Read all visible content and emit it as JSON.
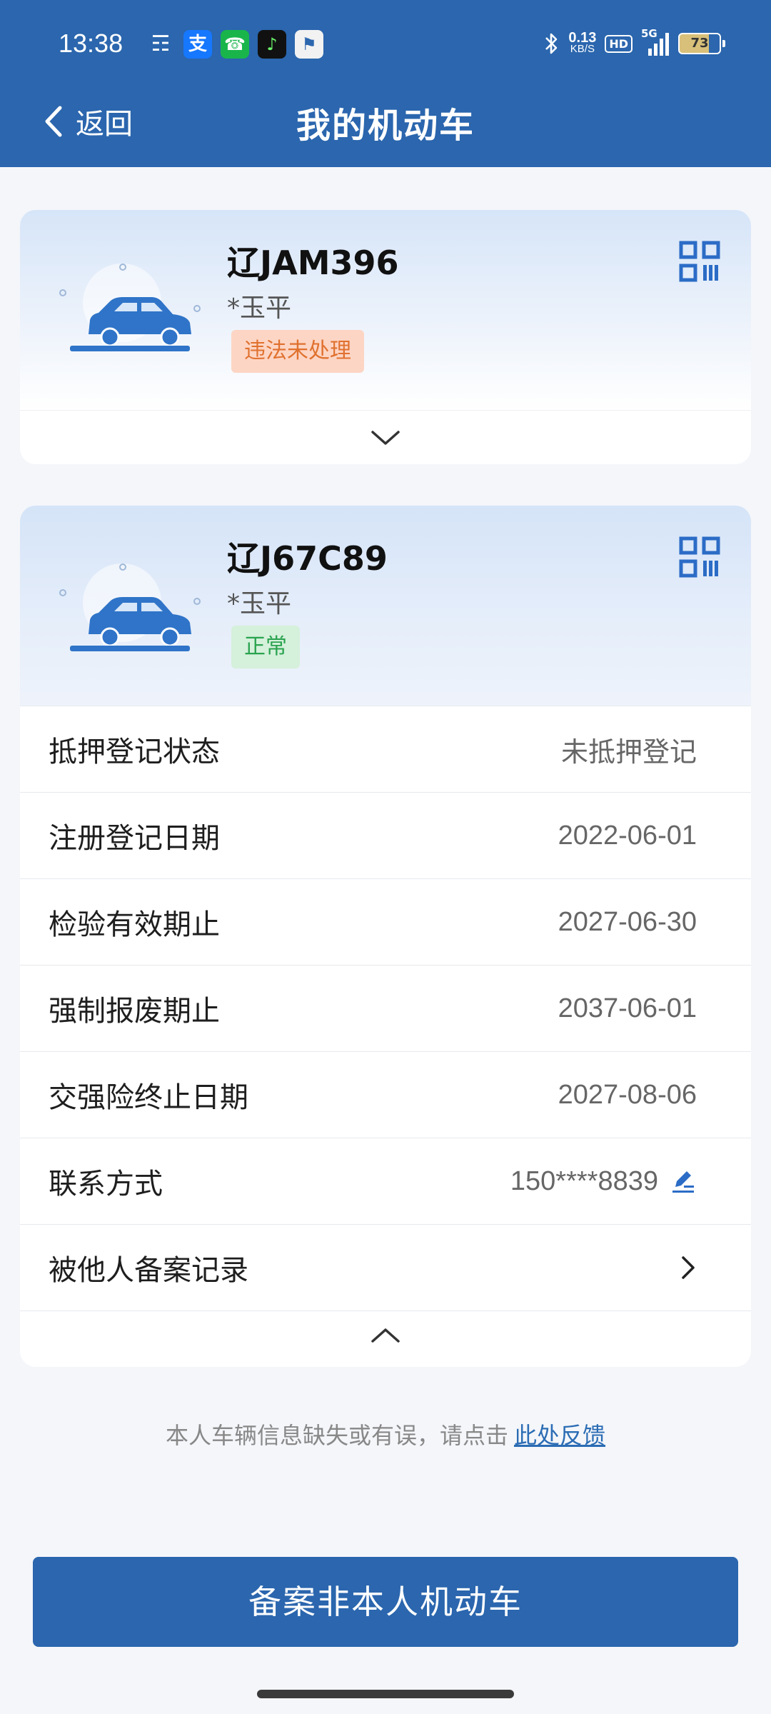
{
  "status_bar": {
    "time": "13:38",
    "apps": [
      {
        "name": "wechat",
        "glyph": "☶",
        "color": "#3d8ef0"
      },
      {
        "name": "alipay",
        "glyph": "支",
        "color": "#1677ff"
      },
      {
        "name": "phone",
        "glyph": "☎",
        "color": "#19b54b"
      },
      {
        "name": "tiktok",
        "glyph": "♪",
        "color": "#111111"
      },
      {
        "name": "news",
        "glyph": "⚑",
        "color": "#f0f0f0"
      }
    ],
    "net_speed_value": "0.13",
    "net_speed_unit": "KB/S",
    "hd": "HD",
    "network": "5G",
    "battery": "73"
  },
  "header": {
    "back_label": "返回",
    "title": "我的机动车"
  },
  "vehicles": [
    {
      "plate": "辽JAM396",
      "owner": "*玉平",
      "status": "违法未处理",
      "status_color": "#e0712f",
      "expanded": false
    },
    {
      "plate": "辽J67C89",
      "owner": "*玉平",
      "status": "正常",
      "status_color": "#2aa34f",
      "expanded": true,
      "details": [
        {
          "label": "抵押登记状态",
          "value": "未抵押登记"
        },
        {
          "label": "注册登记日期",
          "value": "2022-06-01"
        },
        {
          "label": "检验有效期止",
          "value": "2027-06-30"
        },
        {
          "label": "强制报废期止",
          "value": "2037-06-01"
        },
        {
          "label": "交强险终止日期",
          "value": "2027-08-06"
        },
        {
          "label": "联系方式",
          "value": "150****8839"
        },
        {
          "label": "被他人备案记录",
          "value": ""
        }
      ]
    }
  ],
  "icons": {
    "back": "chevron-left-icon",
    "qr": "qr-code-icon",
    "expand": "chevron-down-icon",
    "collapse": "chevron-up-icon",
    "edit": "edit-pen-icon",
    "row_arrow": "chevron-right-icon",
    "car": "car-icon"
  },
  "feedback": {
    "text": "本人车辆信息缺失或有误，请点击",
    "link": "此处反馈"
  },
  "primary_button": "备案非本人机动车",
  "colors": {
    "brand": "#2b66ae",
    "link": "#2b6cb4",
    "page_bg": "#f4f6fa"
  }
}
